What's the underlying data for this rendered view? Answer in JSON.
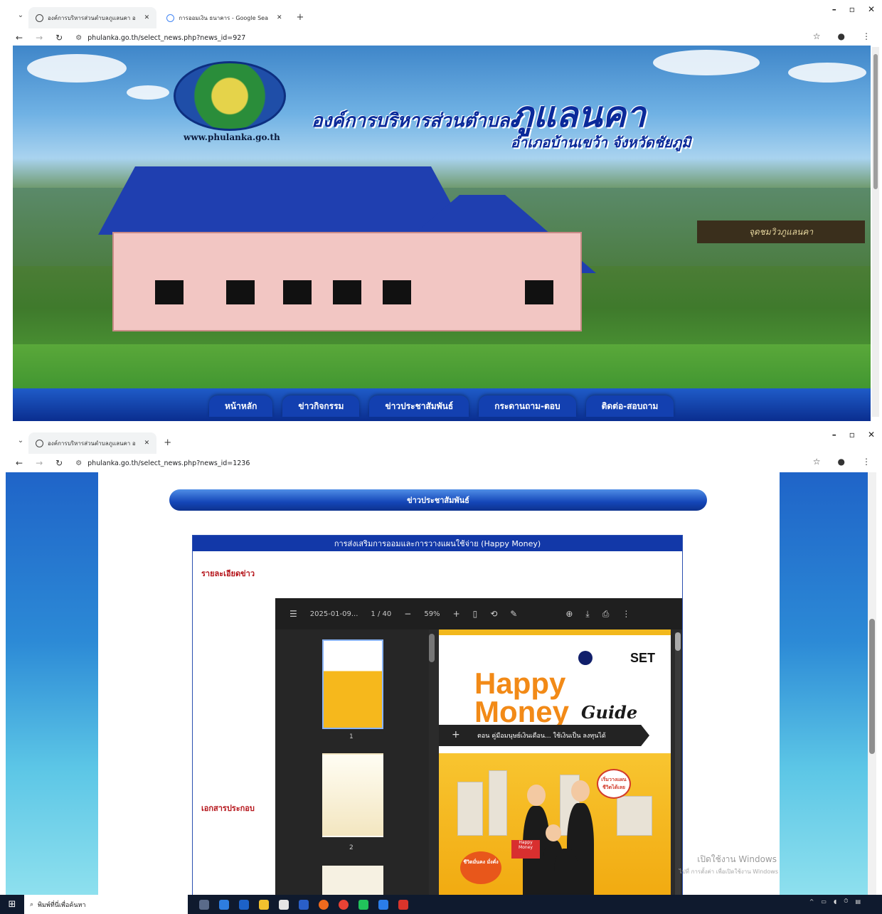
{
  "window1": {
    "tabs": [
      {
        "title": "องค์การบริหารส่วนตำบลภูแลนคา อ"
      },
      {
        "title": "การออมเงิน ธนาคาร - Google Sea"
      }
    ],
    "url": "phulanka.go.th/select_news.php?news_id=927",
    "banner": {
      "website": "www.phulanka.go.th",
      "org_prefix": "องค์การบริหารส่วนตำบล",
      "org_name": "ภูแลนคา",
      "district": "อำเภอบ้านเขว้า จังหวัดชัยภูมิ",
      "sign_text": "จุดชมวิวภูแลนคา"
    },
    "menu": [
      "หน้าหลัก",
      "ข่าวกิจกรรม",
      "ข่าวประชาสัมพันธ์",
      "กระดานถาม-ตอบ",
      "ติดต่อ-สอบถาม"
    ]
  },
  "window2": {
    "tabs": [
      {
        "title": "องค์การบริหารส่วนตำบลภูแลนคา อ"
      }
    ],
    "url": "phulanka.go.th/select_news.php?news_id=1236",
    "section_title": "ข่าวประชาสัมพันธ์",
    "news_title": "การส่งเสริมการออมและการวางแผนใช้จ่าย (Happy Money)",
    "detail_label": "รายละเอียดข่าว",
    "attachment_label": "เอกสารประกอบ",
    "pdf": {
      "filename": "2025-01-09...",
      "page_current": "1",
      "page_total": "40",
      "zoom": "59%",
      "thumb_pages": [
        "1",
        "2"
      ],
      "cover": {
        "brand": "SET",
        "title_line1": "Happy",
        "title_line2": "Money",
        "title_line3": "Guide",
        "tagline": "ตอน คู่มือมนุษย์เงินเดือน... ใช้เงินเป็น ลงทุนได้",
        "badge_text": "เริ่มวางแผนชีวิตได้เลย",
        "bag_text": "Happy Money",
        "orange_badge": "ชีวิตมั่นคง มั่งคั่ง"
      }
    },
    "watermark_line1": "เปิดใช้งาน Windows",
    "watermark_line2": "ไปที่ การตั้งค่า เพื่อเปิดใช้งาน Windows"
  },
  "taskbar": {
    "search_placeholder": "พิมพ์ที่นี่เพื่อค้นหา"
  }
}
